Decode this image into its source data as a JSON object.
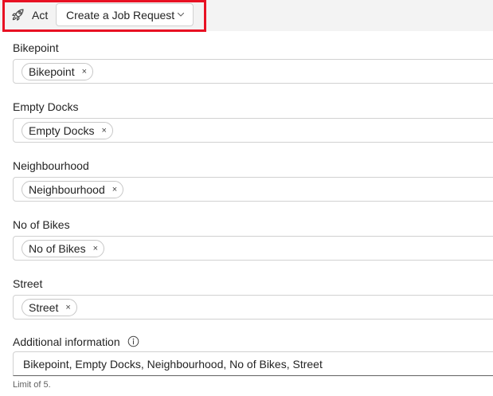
{
  "toolbar": {
    "act_icon": "rocket-icon",
    "act_label": "Act",
    "create_button_label": "Create a Job Request",
    "highlight_color": "#e81123"
  },
  "fields": [
    {
      "label": "Bikepoint",
      "tag": "Bikepoint"
    },
    {
      "label": "Empty Docks",
      "tag": "Empty Docks"
    },
    {
      "label": "Neighbourhood",
      "tag": "Neighbourhood"
    },
    {
      "label": "No of Bikes",
      "tag": "No of Bikes"
    },
    {
      "label": "Street",
      "tag": "Street"
    }
  ],
  "tag_remove_glyph": "×",
  "additional": {
    "label": "Additional information",
    "info_icon": "info-icon",
    "value": "Bikepoint, Empty Docks, Neighbourhood, No of Bikes, Street",
    "limit_text": "Limit of 5."
  }
}
